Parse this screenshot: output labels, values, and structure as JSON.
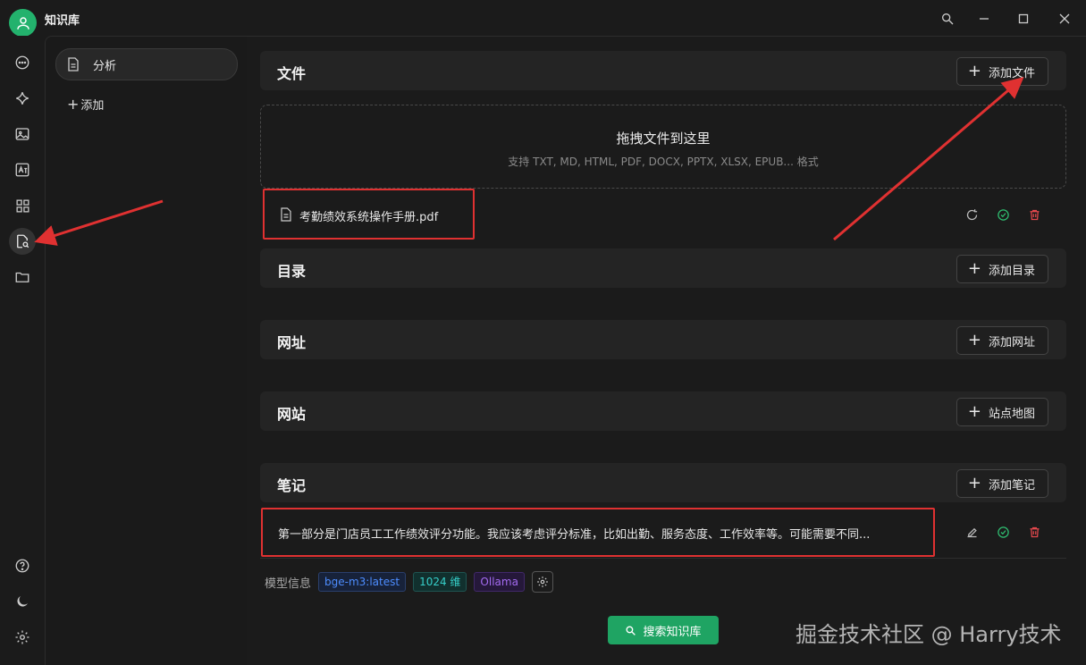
{
  "window": {
    "title": "知识库"
  },
  "knowledge_bases": {
    "items": [
      {
        "label": "分析"
      }
    ],
    "add_label": "添加"
  },
  "sections": {
    "files": {
      "title": "文件",
      "add_label": "添加文件"
    },
    "dropzone": {
      "title": "拖拽文件到这里",
      "subtitle": "支持 TXT, MD, HTML, PDF, DOCX, PPTX, XLSX, EPUB... 格式"
    },
    "file_list": [
      {
        "name": "考勤绩效系统操作手册.pdf"
      }
    ],
    "directories": {
      "title": "目录",
      "add_label": "添加目录"
    },
    "urls": {
      "title": "网址",
      "add_label": "添加网址"
    },
    "websites": {
      "title": "网站",
      "add_label": "站点地图"
    },
    "notes": {
      "title": "笔记",
      "add_label": "添加笔记"
    },
    "note_list": [
      {
        "text": "第一部分是门店员工工作绩效评分功能。我应该考虑评分标准，比如出勤、服务态度、工作效率等。可能需要不同..."
      }
    ]
  },
  "model_info": {
    "label": "模型信息",
    "model": "bge-m3:latest",
    "dimensions": "1024 维",
    "provider": "Ollama"
  },
  "search_button": {
    "label": "搜索知识库"
  },
  "watermark": "掘金技术社区 @ Harry技术",
  "colors": {
    "accent": "#23b26d",
    "search_button": "#1fa463",
    "highlight": "#e03131",
    "success": "#2fbf71",
    "danger": "#e5484d"
  }
}
